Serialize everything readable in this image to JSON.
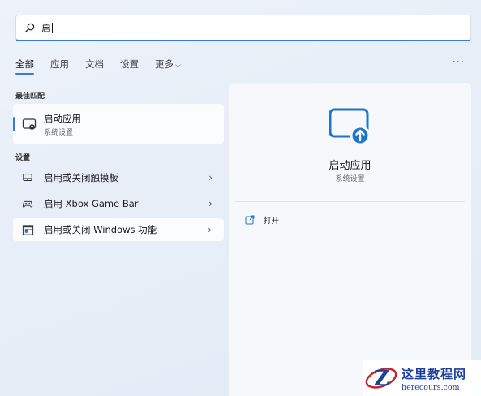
{
  "search": {
    "value": "启"
  },
  "tabs": [
    {
      "label": "全部",
      "active": true
    },
    {
      "label": "应用"
    },
    {
      "label": "文档"
    },
    {
      "label": "设置"
    },
    {
      "label": "更多"
    }
  ],
  "more_icon": "ellipsis-icon",
  "sections": {
    "best_match": "最佳匹配",
    "settings": "设置"
  },
  "best_match": {
    "title": "启动应用",
    "subtitle": "系统设置",
    "icon": "startup-apps-icon"
  },
  "settings_items": [
    {
      "label": "启用或关闭触摸板",
      "icon": "touchpad-icon"
    },
    {
      "label": "启用 Xbox Game Bar",
      "icon": "gamebar-icon"
    },
    {
      "label": "启用或关闭 Windows 功能",
      "icon": "windows-features-icon"
    }
  ],
  "detail": {
    "title": "启动应用",
    "subtitle": "系统设置",
    "action_label": "打开",
    "icon": "startup-apps-large-icon",
    "accent": "#1f76c9"
  },
  "watermark": {
    "title": "这里教程网",
    "url": "herecours.com"
  }
}
